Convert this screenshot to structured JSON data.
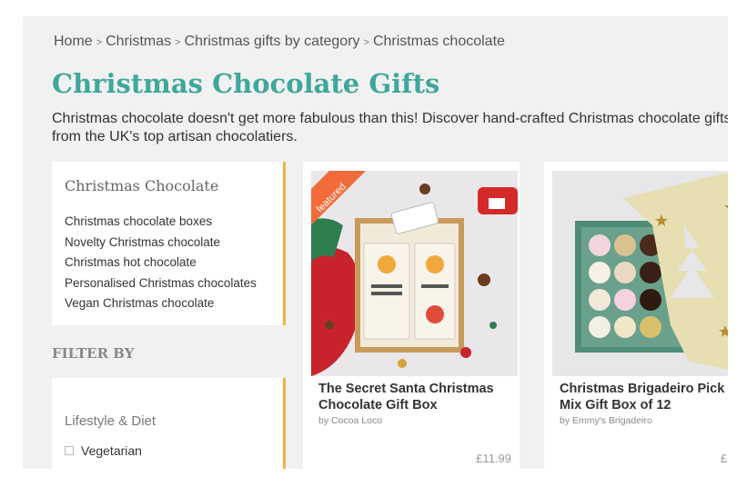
{
  "breadcrumb": [
    {
      "label": "Home"
    },
    {
      "label": "Christmas"
    },
    {
      "label": "Christmas gifts by category"
    },
    {
      "label": "Christmas chocolate"
    }
  ],
  "breadcrumb_separator": ">",
  "page": {
    "title": "Christmas Chocolate Gifts",
    "intro": "Christmas chocolate doesn't get more fabulous than this!  Discover hand-crafted Christmas chocolate gifts from the UK's top artisan chocolatiers."
  },
  "sidebar": {
    "category_title": "Christmas Chocolate",
    "categories": [
      "Christmas chocolate boxes",
      "Novelty Christmas chocolate",
      "Christmas hot chocolate",
      "Personalised Christmas chocolates",
      "Vegan Christmas chocolate"
    ],
    "filter_heading": "FILTER BY",
    "filter_group": "Lifestyle & Diet",
    "filter_options": [
      "Vegetarian"
    ]
  },
  "products": [
    {
      "title": "The Secret Santa Christmas Chocolate Gift Box",
      "vendor": "by Cocoa Loco",
      "price": "£11.99",
      "badge": "featured",
      "image_icon": "chocolate-bars-gift-box-photo",
      "badge_color": "#f26b3a"
    },
    {
      "title": "Christmas Brigadeiro Pick & Mix Gift Box of 12",
      "vendor": "by Emmy's Brigadeiro",
      "price": "£",
      "image_icon": "brigadeiro-truffle-box-photo"
    }
  ],
  "colors": {
    "accent": "#3fa79b",
    "panel_border": "#f0b43c",
    "background": "#f1f1f1"
  }
}
